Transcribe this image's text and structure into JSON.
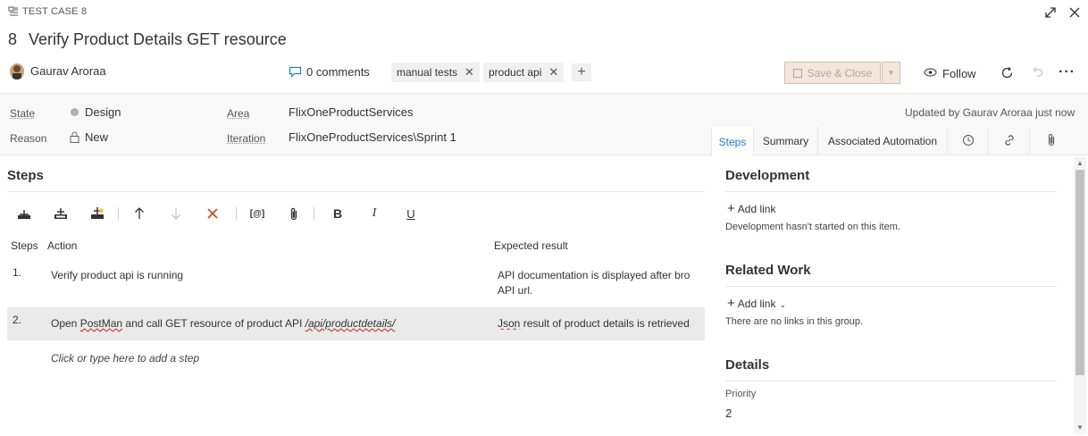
{
  "header": {
    "type_label": "TEST CASE 8",
    "id": "8",
    "title": "Verify Product Details GET resource",
    "assignee": "Gaurav Aroraa",
    "comments": "0 comments",
    "tags": [
      "manual tests",
      "product api"
    ],
    "save_label": "Save & Close",
    "follow_label": "Follow"
  },
  "fields": {
    "state_label": "State",
    "state_value": "Design",
    "reason_label": "Reason",
    "reason_value": "New",
    "area_label": "Area",
    "area_value": "FlixOneProductServices",
    "iteration_label": "Iteration",
    "iteration_value": "FlixOneProductServices\\Sprint 1",
    "updated": "Updated by Gaurav Aroraa just now"
  },
  "tabs": [
    "Steps",
    "Summary",
    "Associated Automation"
  ],
  "steps": {
    "title": "Steps",
    "col_steps": "Steps",
    "col_action": "Action",
    "col_expected": "Expected result",
    "rows": [
      {
        "num": "1.",
        "action": "Verify product api is running",
        "expected_line1": "API documentation is displayed after bro",
        "expected_line2": "API url."
      },
      {
        "num": "2.",
        "action_a": "Open ",
        "action_b": "PostMan",
        "action_c": " and call GET resource of product API ",
        "action_d": "/api/productdetails/",
        "expected_a": "Json",
        "expected_b": " result of product details is retrieved"
      }
    ],
    "add_hint": "Click or type here to add a step"
  },
  "right_panel": {
    "development_title": "Development",
    "add_link": "Add link",
    "development_text": "Development hasn't started on this item.",
    "related_title": "Related Work",
    "related_add_link": "Add link",
    "related_text": "There are no links in this group.",
    "details_title": "Details",
    "priority_label": "Priority",
    "priority_value": "2"
  }
}
